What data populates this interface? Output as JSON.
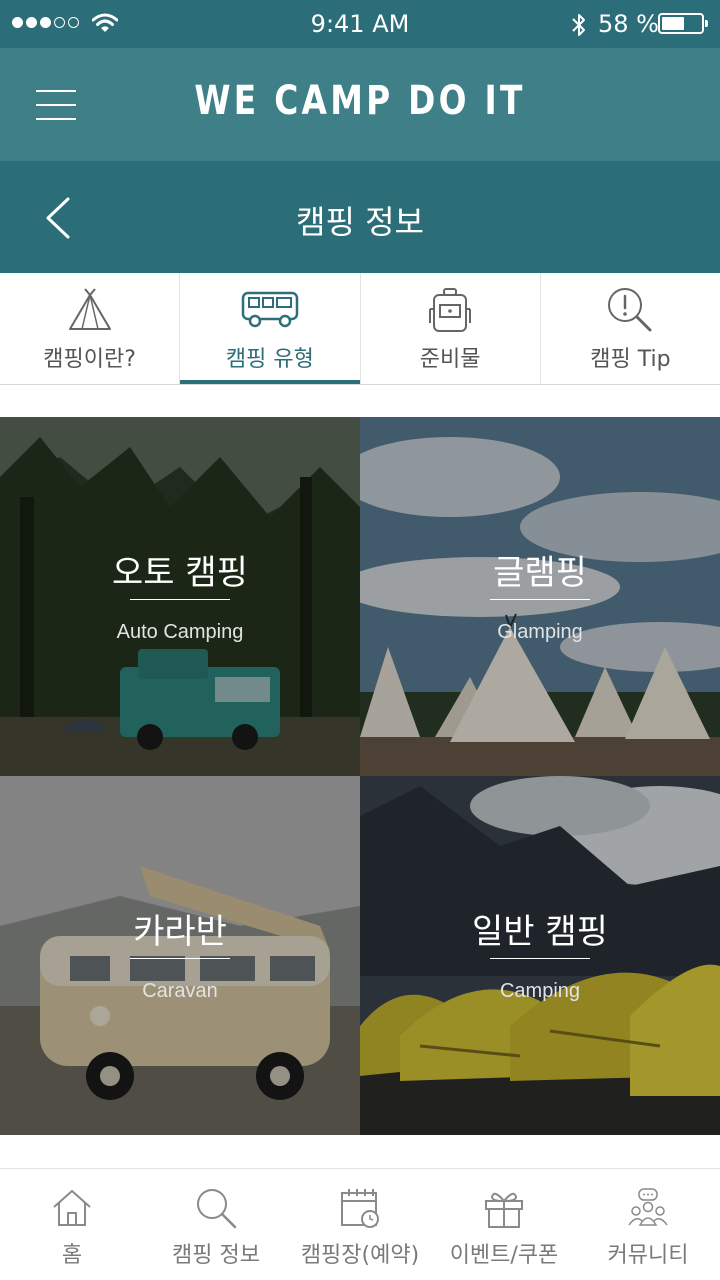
{
  "status_bar": {
    "time": "9:41 AM",
    "battery_percent": "58 %",
    "battery_level": 0.58,
    "signal_bars": 3
  },
  "header": {
    "title": "WE CAMP DO IT",
    "menu_icon": "hamburger-menu-icon"
  },
  "subheader": {
    "title": "캠핑 정보",
    "back_icon": "chevron-left-icon"
  },
  "tabs": [
    {
      "label": "캠핑이란?",
      "icon": "tent-icon",
      "active": false
    },
    {
      "label": "캠핑 유형",
      "icon": "camper-van-icon",
      "active": true
    },
    {
      "label": "준비물",
      "icon": "backpack-icon",
      "active": false
    },
    {
      "label": "캠핑 Tip",
      "icon": "search-alert-icon",
      "active": false
    }
  ],
  "cards": [
    {
      "title": "오토 캠핑",
      "subtitle": "Auto Camping"
    },
    {
      "title": "글램핑",
      "subtitle": "Glamping"
    },
    {
      "title": "카라반",
      "subtitle": "Caravan"
    },
    {
      "title": "일반 캠핑",
      "subtitle": "Camping"
    }
  ],
  "bottom_nav": [
    {
      "label": "홈",
      "icon": "home-icon"
    },
    {
      "label": "캠핑 정보",
      "icon": "search-icon"
    },
    {
      "label": "캠핑장(예약)",
      "icon": "calendar-clock-icon"
    },
    {
      "label": "이벤트/쿠폰",
      "icon": "gift-icon"
    },
    {
      "label": "커뮤니티",
      "icon": "community-icon"
    }
  ],
  "colors": {
    "status_bar": "#2b6d78",
    "app_bar": "#3f7f88",
    "sub_bar": "#2c6e78",
    "accent": "#2d6f79"
  }
}
